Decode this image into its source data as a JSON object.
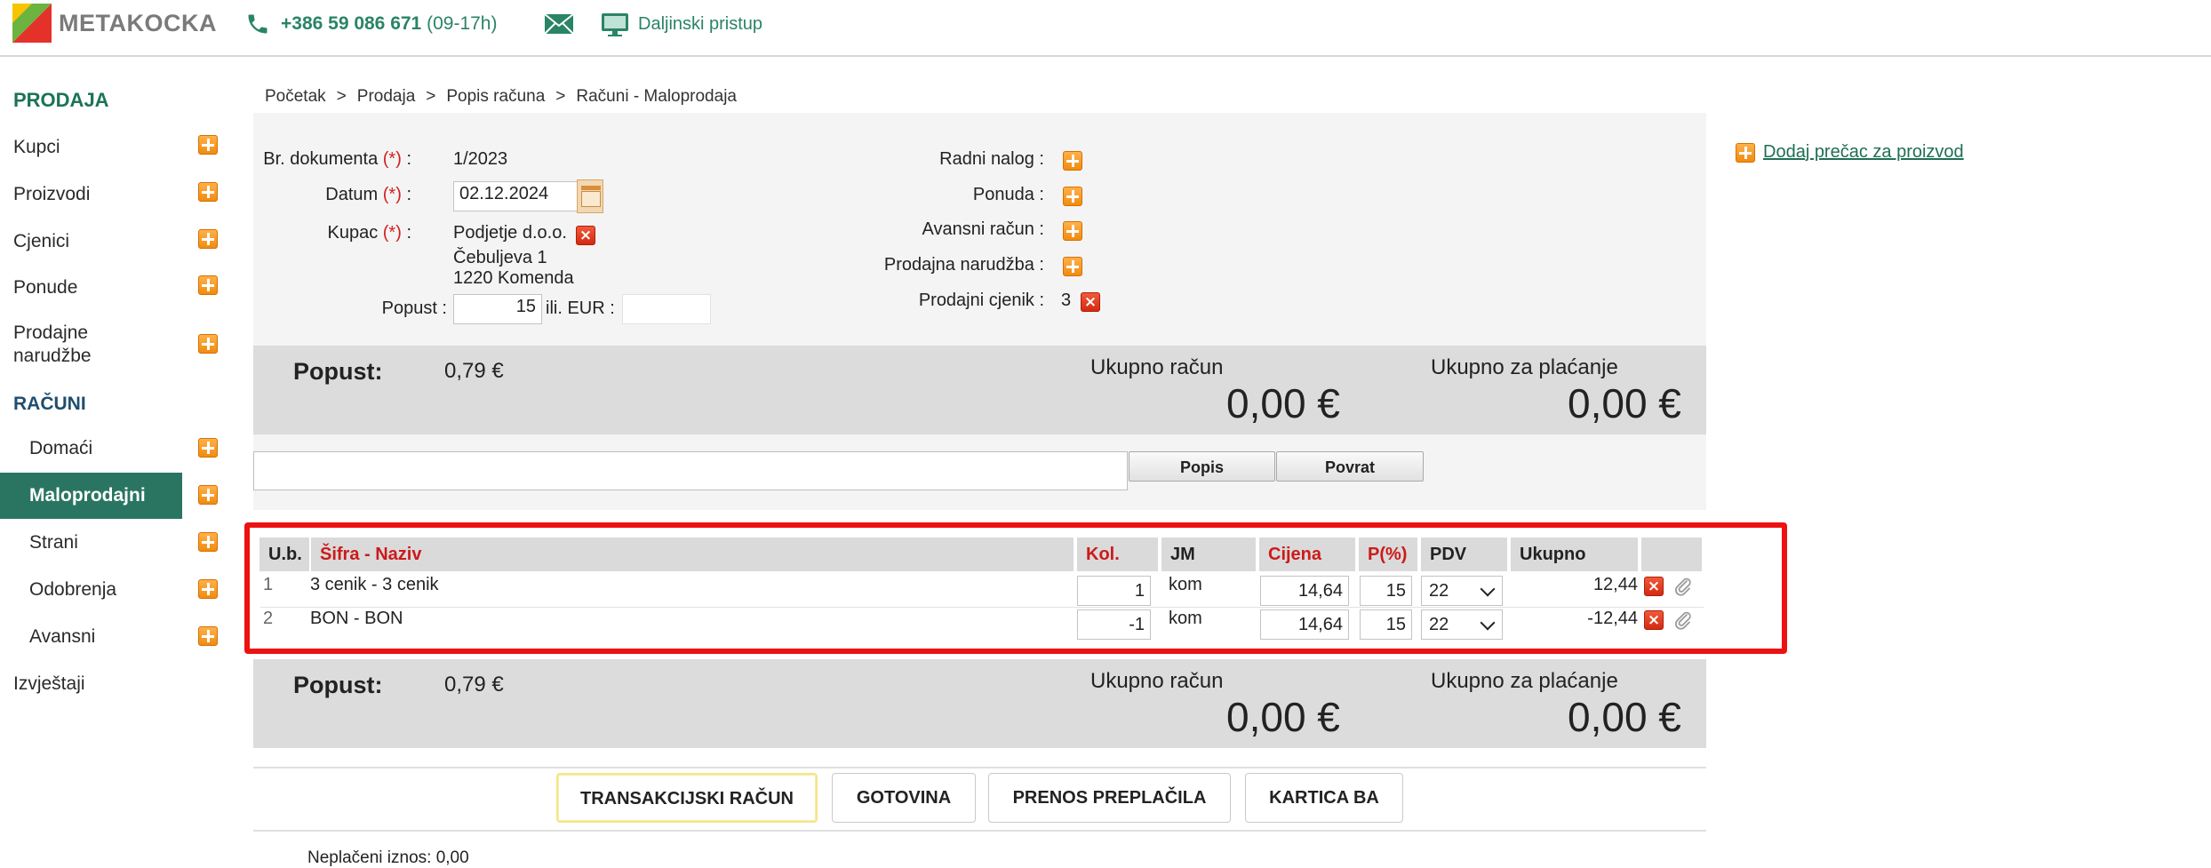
{
  "header": {
    "logo_text": "METAKOCKA",
    "phone": "+386 59 086 671",
    "phone_hours": "(09-17h)",
    "remote_label": "Daljinski pristup"
  },
  "sidebar": {
    "section_sales": "PRODAJA",
    "items": [
      "Kupci",
      "Proizvodi",
      "Cjenici",
      "Ponude"
    ],
    "sales_orders_line1": "Prodajne",
    "sales_orders_line2": "narudžbe",
    "section_invoices": "RAČUNI",
    "invoice_items": [
      "Domaći",
      "Maloprodajni",
      "Strani",
      "Odobrenja",
      "Avansni"
    ],
    "active_item": "Maloprodajni",
    "reports": "Izvještaji"
  },
  "breadcrumb": [
    "Početak",
    "Prodaja",
    "Popis računa",
    "Računi - Maloprodaja"
  ],
  "breadcrumb_sep": ">",
  "form": {
    "doc_number_label": "Br. dokumenta",
    "required_mark": "(*)",
    "doc_number": "1/2023",
    "date_label": "Datum",
    "date": "02.12.2024",
    "customer_label": "Kupac",
    "customer_name": "Podjetje d.o.o.",
    "customer_street": "Čebuljeva 1",
    "customer_city": "1220 Komenda",
    "discount_label": "Popust :",
    "discount_value": "15",
    "or_eur_label": "ili. EUR :",
    "discount_eur": "",
    "colon": ":"
  },
  "form_right": {
    "work_order": "Radni nalog :",
    "quote": "Ponuda :",
    "advance_invoice": "Avansni račun :",
    "sales_order": "Prodajna narudžba :",
    "price_list_label": "Prodajni cjenik :",
    "price_list_value": "3"
  },
  "totals": {
    "discount_label": "Popust:",
    "discount_value": "0,79 €",
    "invoice_total_label": "Ukupno račun",
    "invoice_total": "0,00 €",
    "to_pay_label": "Ukupno za plaćanje",
    "to_pay": "0,00 €"
  },
  "search": {
    "value": "",
    "list_button": "Popis",
    "return_button": "Povrat"
  },
  "table": {
    "headers": [
      "U.b.",
      "Šifra - Naziv",
      "Kol.",
      "JM",
      "Cijena",
      "P(%)",
      "PDV",
      "Ukupno"
    ],
    "rows": [
      {
        "no": "1",
        "name": "3 cenik - 3 cenik",
        "qty": "1",
        "unit": "kom",
        "price": "14,64",
        "discount": "15",
        "vat": "22",
        "total": "12,44"
      },
      {
        "no": "2",
        "name": "BON - BON",
        "qty": "-1",
        "unit": "kom",
        "price": "14,64",
        "discount": "15",
        "vat": "22",
        "total": "-12,44"
      }
    ]
  },
  "payments": [
    "TRANSAKCIJSKI RAČUN",
    "GOTOVINA",
    "PRENOS PREPLAČILA",
    "KARTICA BA"
  ],
  "unpaid_label": "Neplačeni iznos:",
  "unpaid_value": "0,00",
  "shortcut_link": "Dodaj prečac za proizvod",
  "colors": {
    "brand_green": "#2a7562",
    "link_green": "#2a8466",
    "required_red": "#d32020",
    "highlight_red": "#ee1111",
    "plus_orange": "#f08b10"
  }
}
